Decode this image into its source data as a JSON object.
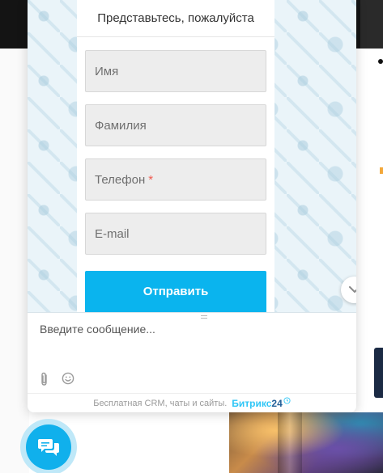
{
  "form": {
    "title": "Представьтесь, пожалуйста",
    "fields": [
      {
        "placeholder": "Имя",
        "required": false
      },
      {
        "placeholder": "Фамилия",
        "required": false
      },
      {
        "placeholder": "Телефон",
        "required": true,
        "required_mark": "*"
      },
      {
        "placeholder": "E-mail",
        "required": false
      }
    ],
    "submit_label": "Отправить"
  },
  "composer": {
    "placeholder": "Введите сообщение..."
  },
  "footer": {
    "text": "Бесплатная CRM, чаты и сайты.",
    "brand_name": "Битрикс",
    "brand_suffix": "24"
  },
  "icons": {
    "scroll_down": "chevron-down-icon",
    "attach": "paperclip-icon",
    "emoji": "smile-icon",
    "launcher": "chat-bubbles-icon"
  },
  "colors": {
    "accent": "#0ab4ee",
    "launcher": "#10b0ec",
    "required": "#f05a4f",
    "brand_light": "#2fc6f6",
    "brand_dark": "#215f98"
  }
}
